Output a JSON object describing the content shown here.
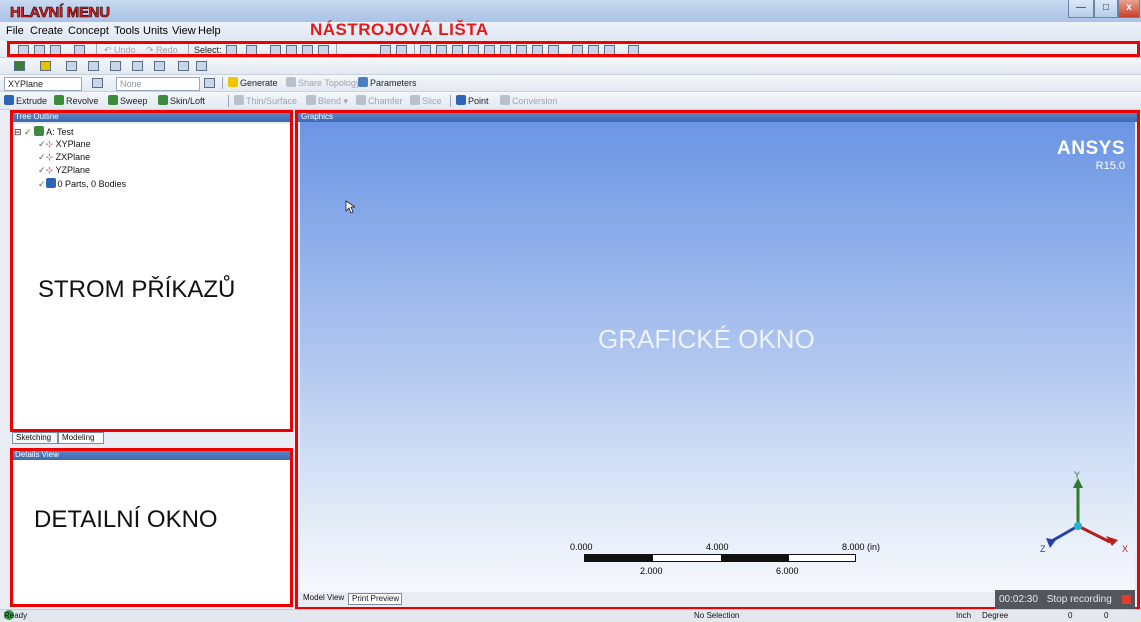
{
  "annotations": {
    "main_menu": "HLAVNÍ MENU",
    "toolbar": "NÁSTROJOVÁ LIŠTA",
    "command_tree": "STROM PŘÍKAZŮ",
    "detail_window": "DETAILNÍ OKNO",
    "graphic_window": "GRAFICKÉ OKNO"
  },
  "window": {
    "min_symbol": "—",
    "max_symbol": "□",
    "close_symbol": "x"
  },
  "menu": [
    "File",
    "Create",
    "Concept",
    "Tools",
    "Units",
    "View",
    "Help"
  ],
  "toolbar1": {
    "undo": "Undo",
    "redo": "Redo",
    "select": "Select:"
  },
  "toolbar3": {
    "plane": "XYPlane",
    "sketch": "None",
    "generate": "Generate",
    "share_topology": "Share Topology",
    "parameters": "Parameters"
  },
  "toolbar4": {
    "extrude": "Extrude",
    "revolve": "Revolve",
    "sweep": "Sweep",
    "skinloft": "Skin/Loft",
    "thin_surface": "Thin/Surface",
    "blend": "Blend",
    "chamfer": "Chamfer",
    "slice": "Slice",
    "point": "Point",
    "conversion": "Conversion"
  },
  "tree": {
    "header": "Tree Outline",
    "root": "A: Test",
    "items": [
      "XYPlane",
      "ZXPlane",
      "YZPlane",
      "0 Parts, 0 Bodies"
    ]
  },
  "left_tabs": [
    "Sketching",
    "Modeling"
  ],
  "details": {
    "header": "Details View"
  },
  "graphics": {
    "header": "Graphics",
    "brand": "ANSYS",
    "version": "R15.0",
    "scale_top": [
      "0.000",
      "4.000",
      "8.000 (in)"
    ],
    "scale_bottom": [
      "2.000",
      "6.000"
    ],
    "axes": {
      "x": "X",
      "y": "Y",
      "z": "Z"
    }
  },
  "bottom_tabs": [
    "Model View",
    "Print Preview"
  ],
  "recording": {
    "time": "00:02:30",
    "stop": "Stop recording"
  },
  "status": {
    "ready": "Ready",
    "selection": "No Selection",
    "units": "Inch",
    "angle": "Degree",
    "v1": "0",
    "v2": "0"
  },
  "colors": {
    "highlight": "#ec0000",
    "graphics_top": "#6b95e4",
    "graphics_bottom": "#f6f8fc"
  }
}
